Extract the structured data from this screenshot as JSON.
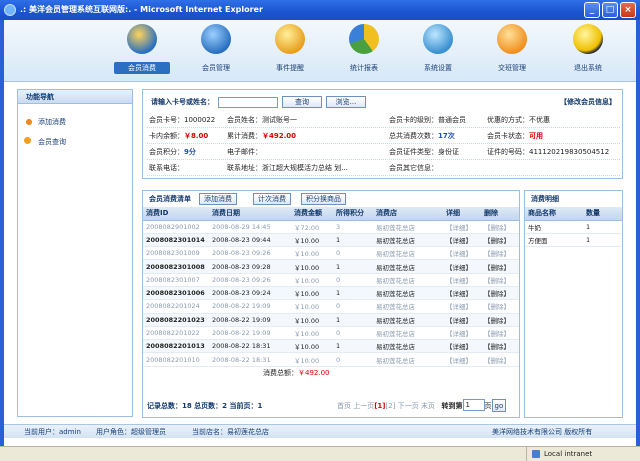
{
  "window": {
    "title": ".: 美洋会员管理系统互联网版:. - Microsoft Internet Explorer",
    "min": "_",
    "max": "□",
    "close": "×"
  },
  "nav": [
    {
      "label": "会员消费",
      "icon": "member-consume-icon",
      "color": "#2a6fc0"
    },
    {
      "label": "会员管理",
      "icon": "member-manage-icon",
      "color": "#3a7fd8"
    },
    {
      "label": "事件提醒",
      "icon": "event-reminder-icon",
      "color": "#e8a020"
    },
    {
      "label": "统计报表",
      "icon": "statistics-report-icon",
      "color": "#f0c020"
    },
    {
      "label": "系统设置",
      "icon": "system-settings-icon",
      "color": "#3a90d0"
    },
    {
      "label": "交班管理",
      "icon": "shift-manage-icon",
      "color": "#f09020"
    },
    {
      "label": "退出系统",
      "icon": "logout-icon",
      "color": "#f0c000"
    }
  ],
  "sidebar": {
    "title": "功能导航",
    "items": [
      "添加消费",
      "会员查询"
    ]
  },
  "search": {
    "label": "请输入卡号或姓名：",
    "query_btn": "查询",
    "browse_btn": "浏览...",
    "modify_link": "【修改会员信息】"
  },
  "info": {
    "r1": [
      "会员卡号：1000022",
      "会员姓名：测试账号一",
      "会员卡的级别：普通会员",
      "优惠的方式：不优惠"
    ],
    "r2": {
      "a": "卡内余额：",
      "a_val": "￥8.00",
      "b": "累计消费：",
      "b_val": "￥492.00",
      "c": "总共消费次数：",
      "c_val": "17次",
      "d": "会员卡状态：",
      "d_val": "可用"
    },
    "r3": {
      "a": "会员积分：",
      "a_val": "9分",
      "b": "电子邮件：",
      "c": "会员证件类型：身份证",
      "d": "证件的号码：411120219830504512"
    },
    "r4": [
      "联系电话：",
      "联系地址：浙江超大规模活力总结 划...",
      "会员其它信息："
    ]
  },
  "list": {
    "title": "会员消费清单",
    "btns": [
      "添加消费",
      "计次消费",
      "积分换商品"
    ],
    "headers": [
      "消费ID",
      "消费日期",
      "消费金额",
      "所得积分",
      "消费店",
      "详细",
      "删除"
    ],
    "rows": [
      [
        "2008082901002",
        "2008-08-29 14:45",
        "￥72.00",
        "3",
        "易初莲花总店",
        "【详细】",
        "【删除】"
      ],
      [
        "2008082301014",
        "2008-08-23 09:44",
        "￥10.00",
        "1",
        "易初莲花总店",
        "【详细】",
        "【删除】"
      ],
      [
        "2008082301009",
        "2008-08-23 09:26",
        "￥10.00",
        "0",
        "易初莲花总店",
        "【详细】",
        "【删除】"
      ],
      [
        "2008082301008",
        "2008-08-23 09:28",
        "￥10.00",
        "1",
        "易初莲花总店",
        "【详细】",
        "【删除】"
      ],
      [
        "2008082301007",
        "2008-08-23 09:26",
        "￥10.00",
        "0",
        "易初莲花总店",
        "【详细】",
        "【删除】"
      ],
      [
        "2008082301006",
        "2008-08-23 09:24",
        "￥10.00",
        "1",
        "易初莲花总店",
        "【详细】",
        "【删除】"
      ],
      [
        "2008082201024",
        "2008-08-22 19:09",
        "￥10.00",
        "0",
        "易初莲花总店",
        "【详细】",
        "【删除】"
      ],
      [
        "2008082201023",
        "2008-08-22 19:09",
        "￥10.00",
        "1",
        "易初莲花总店",
        "【详细】",
        "【删除】"
      ],
      [
        "2008082201022",
        "2008-08-22 19:09",
        "￥10.00",
        "0",
        "易初莲花总店",
        "【详细】",
        "【删除】"
      ],
      [
        "2008082201013",
        "2008-08-22 18:31",
        "￥10.00",
        "1",
        "易初莲花总店",
        "【详细】",
        "【删除】"
      ],
      [
        "2008082201010",
        "2008-08-22 18:31",
        "￥10.00",
        "0",
        "易初莲花总店",
        "【详细】",
        "【删除】"
      ]
    ],
    "total_label": "消费总额：",
    "total_val": "￥492.00",
    "pager": {
      "info": "记录总数：18  总页数：2  当前页：1",
      "links": "首页 上一页",
      "cur": "[1]",
      "rest": "[2] 下一页 末页",
      "goto": "转到第",
      "page_val": "1",
      "page_unit": "页",
      "go": "go"
    }
  },
  "detail": {
    "title": "消费明细",
    "headers": [
      "商品名称",
      "数量"
    ],
    "rows": [
      [
        "牛奶",
        "1"
      ],
      [
        "方便面",
        "1"
      ]
    ]
  },
  "status": {
    "user": "当前用户：admin",
    "role": "用户角色：超级管理员",
    "store": "当前店名：易初莲花总店",
    "company": "美洋网络技术有限公司  版权所有"
  },
  "ie": {
    "zone": "Local intranet"
  }
}
